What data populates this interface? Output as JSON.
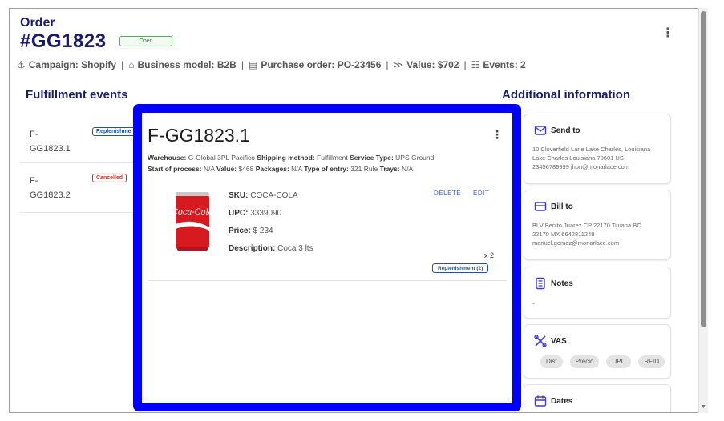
{
  "order": {
    "label": "Order",
    "id": "#GG1823",
    "status": "Open",
    "meta": [
      {
        "icon": "tag-icon",
        "glyph": "⚓",
        "text": "Campaign: Shopify"
      },
      {
        "icon": "building-icon",
        "glyph": "⌂",
        "text": "Business model: B2B"
      },
      {
        "icon": "document-icon",
        "glyph": "▤",
        "text": "Purchase order: PO-23456"
      },
      {
        "icon": "value-icon",
        "glyph": "≫",
        "text": "Value: $702"
      },
      {
        "icon": "events-icon",
        "glyph": "☷",
        "text": "Events: 2"
      }
    ]
  },
  "sections": {
    "fulfillment_title": "Fulfillment events",
    "additional_title": "Additional information"
  },
  "events": [
    {
      "id_line1": "F-",
      "id_line2": "GG1823.1",
      "badge": "Replenishme",
      "badge_color": "#1e4fbf"
    },
    {
      "id_line1": "F-",
      "id_line2": "GG1823.2",
      "badge": "Cancelled",
      "badge_color": "#d32f2f"
    }
  ],
  "modal": {
    "title": "F-GG1823.1",
    "info_line1": [
      {
        "label": "Warehouse:",
        "value": "G-Global 3PL Pacifico"
      },
      {
        "label": "Shipping method:",
        "value": "Fulfillment"
      },
      {
        "label": "Service Type:",
        "value": "UPS Ground"
      }
    ],
    "info_line2": [
      {
        "label": "Start of process:",
        "value": "N/A"
      },
      {
        "label": "Value:",
        "value": "$468"
      },
      {
        "label": "Packages:",
        "value": "N/A"
      },
      {
        "label": "Type of entry:",
        "value": "321 Rule"
      },
      {
        "label": "Trays:",
        "value": "N/A"
      }
    ],
    "product": {
      "sku_label": "SKU:",
      "sku": "COCA-COLA",
      "upc_label": "UPC:",
      "upc": "3339090",
      "price_label": "Price:",
      "price": "$ 234",
      "desc_label": "Description:",
      "desc": "Coca 3 lts",
      "image_brand": "Coca-Cola",
      "qty": "x 2",
      "badge": "Replenishment (2)",
      "delete_label": "DELETE",
      "edit_label": "EDIT"
    }
  },
  "cards": {
    "send_to": {
      "title": "Send to",
      "lines": [
        "10 Cloverfield Lane Lake Charles, Louisiana",
        "Lake Charles Louisiana 70601 US",
        "23456789999 jhon@monarlace.com"
      ]
    },
    "bill_to": {
      "title": "Bill to",
      "lines": [
        "BLV Benito Juarez CP 22170 Tijuana BC",
        "22170 MX 6642811248",
        "manuel.gomez@monarlace.com"
      ]
    },
    "notes": {
      "title": "Notes",
      "text": "-"
    },
    "vas": {
      "title": "VAS",
      "chips": [
        "Dist",
        "Precio",
        "UPC",
        "RFID"
      ]
    },
    "dates": {
      "title": "Dates"
    }
  },
  "colors": {
    "brand": "#1a1a6e",
    "accent": "#3b3ad9",
    "highlight_border": "#0000ff",
    "open_green": "#2e7d32"
  }
}
